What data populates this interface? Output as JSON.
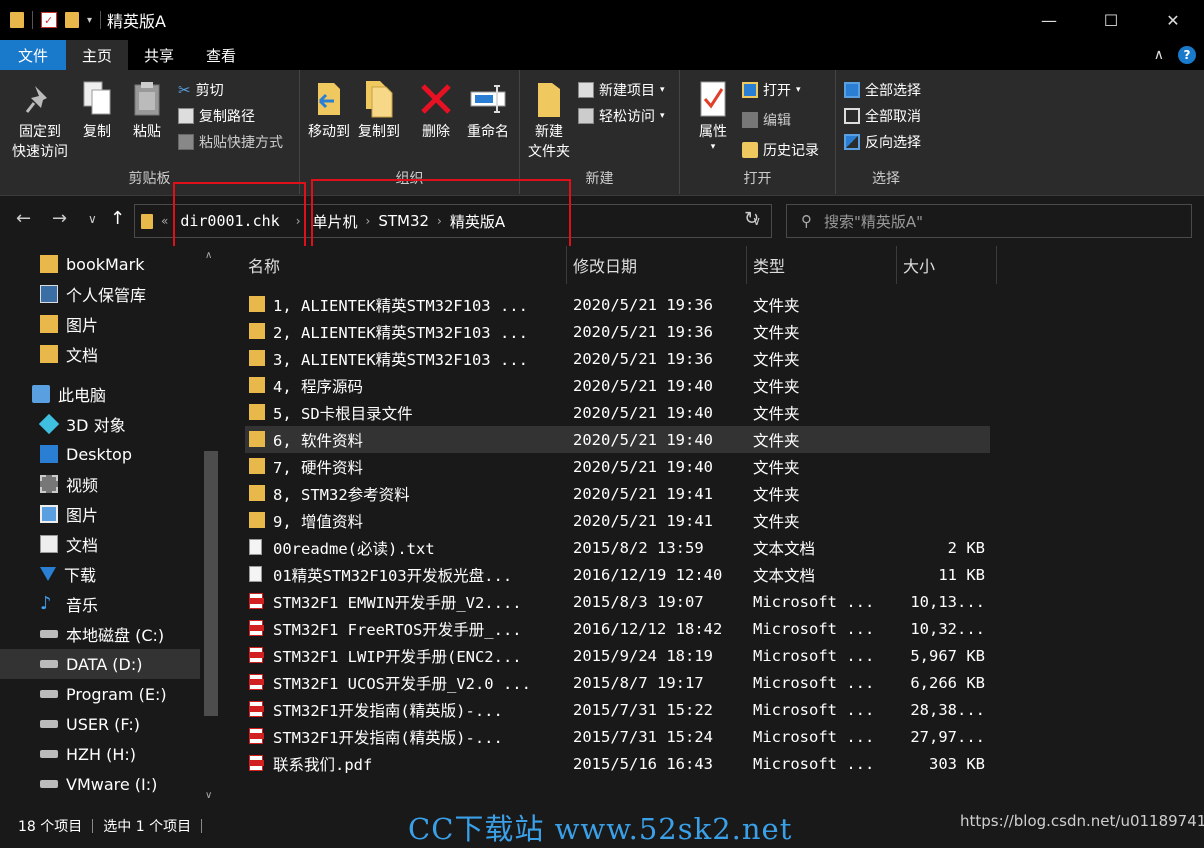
{
  "window": {
    "title": "精英版A"
  },
  "ribbon_tabs": [
    "文件",
    "主页",
    "共享",
    "查看"
  ],
  "ribbon": {
    "clipboard": {
      "pin": "固定到\n快速访问",
      "copy": "复制",
      "paste": "粘贴",
      "cut": "剪切",
      "copy_path": "复制路径",
      "paste_shortcut": "粘贴快捷方式",
      "label": "剪贴板"
    },
    "organize": {
      "move_to": "移动到",
      "copy_to": "复制到",
      "delete": "删除",
      "rename": "重命名",
      "label": "组织"
    },
    "new": {
      "new_folder": "新建\n文件夹",
      "new_item": "新建项目",
      "easy_access": "轻松访问",
      "label": "新建"
    },
    "open": {
      "properties": "属性",
      "open": "打开",
      "edit": "编辑",
      "history": "历史记录",
      "label": "打开"
    },
    "select": {
      "select_all": "全部选择",
      "select_none": "全部取消",
      "invert": "反向选择",
      "label": "选择"
    }
  },
  "address": {
    "root": "dir0001.chk",
    "crumbs": [
      "单片机",
      "STM32",
      "精英版A"
    ]
  },
  "search": {
    "placeholder": "搜索\"精英版A\""
  },
  "sidebar": [
    {
      "label": "bookMark",
      "icon": "folder-icon"
    },
    {
      "label": "个人保管库",
      "icon": "vault-icon"
    },
    {
      "label": "图片",
      "icon": "folder-icon"
    },
    {
      "label": "文档",
      "icon": "folder-icon"
    },
    {
      "label": "此电脑",
      "icon": "computer-icon"
    },
    {
      "label": "3D 对象",
      "icon": "cube-icon"
    },
    {
      "label": "Desktop",
      "icon": "desktop-icon"
    },
    {
      "label": "视频",
      "icon": "video-icon"
    },
    {
      "label": "图片",
      "icon": "picture-icon"
    },
    {
      "label": "文档",
      "icon": "document-icon"
    },
    {
      "label": "下载",
      "icon": "download-icon"
    },
    {
      "label": "音乐",
      "icon": "music-icon"
    },
    {
      "label": "本地磁盘 (C:)",
      "icon": "drive-icon"
    },
    {
      "label": "DATA (D:)",
      "icon": "drive-icon"
    },
    {
      "label": "Program (E:)",
      "icon": "drive-icon"
    },
    {
      "label": "USER (F:)",
      "icon": "drive-icon"
    },
    {
      "label": "HZH (H:)",
      "icon": "drive-icon"
    },
    {
      "label": "VMware (I:)",
      "icon": "drive-icon"
    }
  ],
  "columns": [
    "名称",
    "修改日期",
    "类型",
    "大小"
  ],
  "files": [
    {
      "name": "1, ALIENTEK精英STM32F103 ...",
      "date": "2020/5/21 19:36",
      "type": "文件夹",
      "size": "",
      "icon": "folder-icon"
    },
    {
      "name": "2, ALIENTEK精英STM32F103 ...",
      "date": "2020/5/21 19:36",
      "type": "文件夹",
      "size": "",
      "icon": "folder-icon"
    },
    {
      "name": "3, ALIENTEK精英STM32F103 ...",
      "date": "2020/5/21 19:36",
      "type": "文件夹",
      "size": "",
      "icon": "folder-icon"
    },
    {
      "name": "4, 程序源码",
      "date": "2020/5/21 19:40",
      "type": "文件夹",
      "size": "",
      "icon": "folder-icon"
    },
    {
      "name": "5, SD卡根目录文件",
      "date": "2020/5/21 19:40",
      "type": "文件夹",
      "size": "",
      "icon": "folder-icon"
    },
    {
      "name": "6, 软件资料",
      "date": "2020/5/21 19:40",
      "type": "文件夹",
      "size": "",
      "icon": "folder-icon"
    },
    {
      "name": "7, 硬件资料",
      "date": "2020/5/21 19:40",
      "type": "文件夹",
      "size": "",
      "icon": "folder-icon"
    },
    {
      "name": "8, STM32参考资料",
      "date": "2020/5/21 19:41",
      "type": "文件夹",
      "size": "",
      "icon": "folder-icon"
    },
    {
      "name": "9, 增值资料",
      "date": "2020/5/21 19:41",
      "type": "文件夹",
      "size": "",
      "icon": "folder-icon"
    },
    {
      "name": "00readme(必读).txt",
      "date": "2015/8/2 13:59",
      "type": "文本文档",
      "size": "2 KB",
      "icon": "text-file-icon"
    },
    {
      "name": "01精英STM32F103开发板光盘...",
      "date": "2016/12/19 12:40",
      "type": "文本文档",
      "size": "11 KB",
      "icon": "text-file-icon"
    },
    {
      "name": "STM32F1 EMWIN开发手册_V2....",
      "date": "2015/8/3 19:07",
      "type": "Microsoft ...",
      "size": "10,13...",
      "icon": "pdf-icon"
    },
    {
      "name": "STM32F1 FreeRTOS开发手册_...",
      "date": "2016/12/12 18:42",
      "type": "Microsoft ...",
      "size": "10,32...",
      "icon": "pdf-icon"
    },
    {
      "name": "STM32F1 LWIP开发手册(ENC2...",
      "date": "2015/9/24 18:19",
      "type": "Microsoft ...",
      "size": "5,967 KB",
      "icon": "pdf-icon"
    },
    {
      "name": "STM32F1 UCOS开发手册_V2.0 ...",
      "date": "2015/8/7 19:17",
      "type": "Microsoft ...",
      "size": "6,266 KB",
      "icon": "pdf-icon"
    },
    {
      "name": "STM32F1开发指南(精英版)-...",
      "date": "2015/7/31 15:22",
      "type": "Microsoft ...",
      "size": "28,38...",
      "icon": "pdf-icon"
    },
    {
      "name": "STM32F1开发指南(精英版)-...",
      "date": "2015/7/31 15:24",
      "type": "Microsoft ...",
      "size": "27,97...",
      "icon": "pdf-icon"
    },
    {
      "name": "联系我们.pdf",
      "date": "2015/5/16 16:43",
      "type": "Microsoft ...",
      "size": "303 KB",
      "icon": "pdf-icon"
    }
  ],
  "status": {
    "count": "18 个项目",
    "selected": "选中 1 个项目"
  },
  "watermark": {
    "site": "CC下载站 www.52sk2.net",
    "blog": "https://blog.csdn.net/u01189741"
  },
  "colors": {
    "accent": "#1979ca",
    "folder": "#e8b84a",
    "highlight_box": "#e0101a"
  }
}
